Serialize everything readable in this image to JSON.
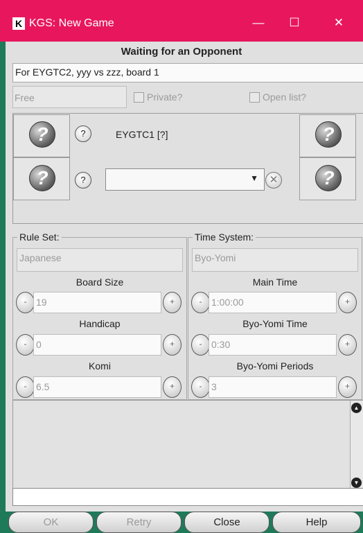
{
  "window": {
    "title": "KGS: New Game",
    "app_icon": "K",
    "minimize_glyph": "—",
    "maximize_glyph": "☐",
    "close_glyph": "✕"
  },
  "header": {
    "title": "Waiting for an Opponent",
    "description": "For EYGTC2, yyy vs zzz, board 1"
  },
  "options": {
    "game_type": "Free",
    "private_label": "Private?",
    "private_checked": false,
    "open_list_label": "Open list?",
    "open_list_checked": false
  },
  "players": {
    "player1_name": "EYGTC1 [?]",
    "player2_value": "",
    "help_glyph": "?",
    "avatar_glyph": "?",
    "combo_arrow": "▼",
    "remove_glyph": "✕"
  },
  "rules": {
    "label": "Rule Set:",
    "value": "Japanese",
    "board_size_label": "Board Size",
    "board_size": "19",
    "handicap_label": "Handicap",
    "handicap": "0",
    "komi_label": "Komi",
    "komi": "6.5",
    "minus_glyph": "-",
    "plus_glyph": "+"
  },
  "time": {
    "label": "Time System:",
    "value": "Byo-Yomi",
    "main_time_label": "Main Time",
    "main_time": "1:00:00",
    "byo_yomi_time_label": "Byo-Yomi Time",
    "byo_yomi_time": "0:30",
    "byo_yomi_periods_label": "Byo-Yomi Periods",
    "byo_yomi_periods": "3"
  },
  "chat": {
    "input_value": "",
    "scroll_up_glyph": "▲",
    "scroll_down_glyph": "▼"
  },
  "buttons": {
    "ok": "OK",
    "retry": "Retry",
    "close": "Close",
    "help": "Help"
  },
  "colors": {
    "titlebar": "#e8175d",
    "frame_green": "#1f7a5a",
    "panel_gray": "#e0e0e0"
  }
}
